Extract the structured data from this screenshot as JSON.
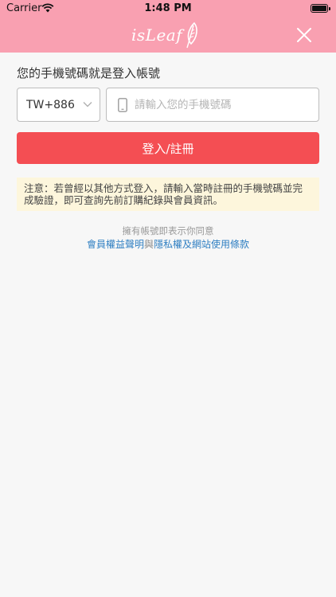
{
  "status_bar": {
    "carrier": "Carrier",
    "time": "1:48 PM"
  },
  "nav": {
    "logo_text": "isLeaf",
    "close_icon": "close-icon"
  },
  "form": {
    "prompt": "您的手機號碼就是登入帳號",
    "country_code": "TW+886",
    "phone_placeholder": "請輸入您的手機號碼",
    "submit_label": "登入/註冊"
  },
  "notice": "注意：若曾經以其他方式登入，請輸入當時註冊的手機號碼並完成驗證，即可查詢先前訂購紀錄與會員資訊。",
  "terms": {
    "agree_text": "擁有帳號即表示你同意",
    "link_member": "會員權益聲明",
    "connector": "與",
    "link_privacy": "隱私權及網站使用條款"
  },
  "colors": {
    "header_bg": "#f9a0b1",
    "primary_button": "#f44e53",
    "notice_bg": "#fdf6dc",
    "link": "#2f7fc2"
  }
}
